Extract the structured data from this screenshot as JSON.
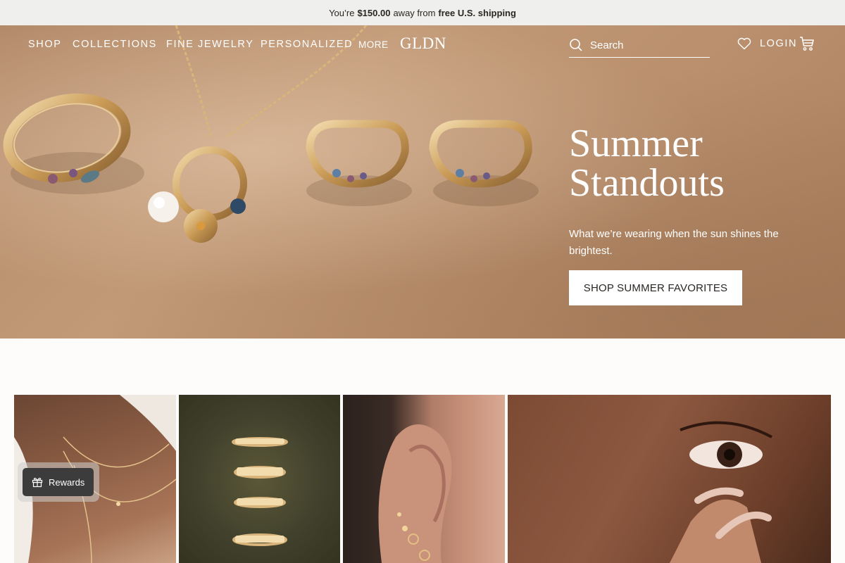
{
  "announcement": {
    "prefix": "You’re",
    "amount": "$150.00",
    "middle": "away from",
    "highlight": "free U.S. shipping"
  },
  "nav": {
    "shop": "SHOP",
    "collections": "COLLECTIONS",
    "fine_jewelry": "FINE JEWELRY",
    "personalized": "PERSONALIZED",
    "more": "MORE",
    "logo": "GLDN",
    "search_placeholder": "Search",
    "login": "LOGIN"
  },
  "hero": {
    "title_line1": "Summer",
    "title_line2": "Standouts",
    "subtitle": "What we’re wearing when the sun shines the brightest.",
    "cta": "SHOP SUMMER FAVORITES"
  },
  "tiles": [
    {
      "name": "layered-necklaces-photo"
    },
    {
      "name": "engraved-rings-photo"
    },
    {
      "name": "ear-stack-photo"
    },
    {
      "name": "face-closeup-photo"
    }
  ],
  "rewards": {
    "label": "Rewards",
    "icon": "gift-icon"
  },
  "colors": {
    "announce_bg": "#efefed",
    "hero_bg": "#b48b6a",
    "rewards_bg": "#3c3c3c"
  }
}
